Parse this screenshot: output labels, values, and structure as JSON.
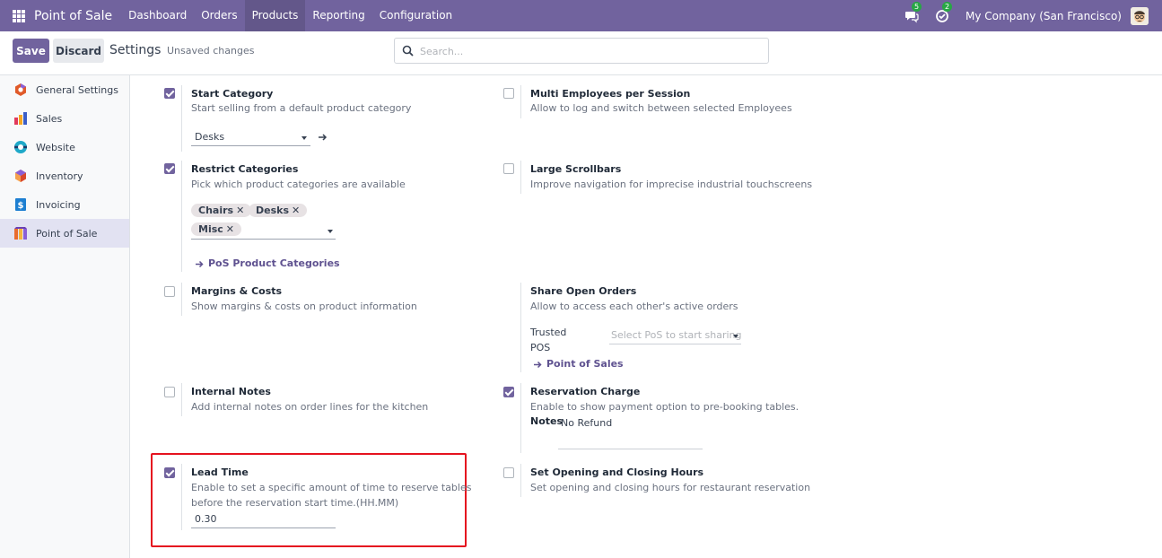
{
  "navbar": {
    "brand": "Point of Sale",
    "menu": [
      "Dashboard",
      "Orders",
      "Products",
      "Reporting",
      "Configuration"
    ],
    "active_menu": "Products",
    "messages_count": "5",
    "activities_count": "2",
    "company": "My Company (San Francisco)",
    "color": "#71639e"
  },
  "control_panel": {
    "save_label": "Save",
    "discard_label": "Discard",
    "title": "Settings",
    "status": "Unsaved changes",
    "search_placeholder": "Search..."
  },
  "sidebar": {
    "items": [
      {
        "label": "General Settings",
        "icon": "general-settings-icon"
      },
      {
        "label": "Sales",
        "icon": "sales-icon"
      },
      {
        "label": "Website",
        "icon": "website-icon"
      },
      {
        "label": "Inventory",
        "icon": "inventory-icon"
      },
      {
        "label": "Invoicing",
        "icon": "invoicing-icon"
      },
      {
        "label": "Point of Sale",
        "icon": "point-of-sale-icon"
      }
    ],
    "active": "Point of Sale"
  },
  "settings": {
    "start_category": {
      "title": "Start Category",
      "desc": "Start selling from a default product category",
      "checked": true,
      "value": "Desks"
    },
    "multi_employees": {
      "title": "Multi Employees per Session",
      "desc": "Allow to log and switch between selected Employees",
      "checked": false
    },
    "restrict_categories": {
      "title": "Restrict Categories",
      "desc": "Pick which product categories are available",
      "checked": true,
      "tags": [
        "Chairs",
        "Desks",
        "Misc"
      ],
      "link": "PoS Product Categories"
    },
    "large_scrollbars": {
      "title": "Large Scrollbars",
      "desc": "Improve navigation for imprecise industrial touchscreens",
      "checked": false
    },
    "margins_costs": {
      "title": "Margins & Costs",
      "desc": "Show margins & costs on product information",
      "checked": false
    },
    "share_open_orders": {
      "title": "Share Open Orders",
      "desc": "Allow to access each other's active orders",
      "field_label_line1": "Trusted",
      "field_label_line2": "POS",
      "placeholder": "Select PoS to start sharing",
      "link": "Point of Sales"
    },
    "internal_notes": {
      "title": "Internal Notes",
      "desc": "Add internal notes on order lines for the kitchen",
      "checked": false
    },
    "reservation_charge": {
      "title": "Reservation Charge",
      "desc": "Enable to show payment option to pre-booking tables.",
      "checked": true,
      "notes_label": "Notes",
      "notes_value": "No Refund"
    },
    "lead_time": {
      "title": "Lead Time",
      "desc_line1": "Enable to set a specific amount of time to reserve tables",
      "desc_line2": "before the reservation start time.(HH.MM)",
      "checked": true,
      "value": "0.30"
    },
    "opening_hours": {
      "title": "Set Opening and Closing Hours",
      "desc": "Set opening and closing hours for restaurant reservation",
      "checked": false
    }
  },
  "highlight_color": "#e5121f"
}
